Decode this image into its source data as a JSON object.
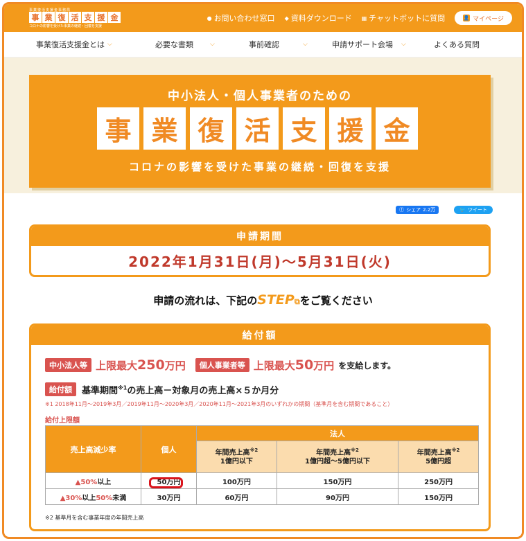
{
  "header": {
    "logo_top": "事業復活支援金事務局",
    "logo_chars": [
      "事",
      "業",
      "復",
      "活",
      "支",
      "援",
      "金"
    ],
    "logo_sub": "コロナの影響を受けた事業の継続・回復を支援",
    "links": [
      {
        "icon": "chat-icon",
        "label": "お問い合わせ窓口"
      },
      {
        "icon": "download-icon",
        "label": "資料ダウンロード"
      },
      {
        "icon": "chatbot-icon",
        "label": "チャットボットに質問"
      }
    ],
    "mypage_label": "マイページ"
  },
  "nav": {
    "items": [
      {
        "label": "事業復活支援金とは",
        "chevron": true
      },
      {
        "label": "必要な書類",
        "chevron": true
      },
      {
        "label": "事前確認",
        "chevron": true
      },
      {
        "label": "申請サポート会場",
        "chevron": true
      },
      {
        "label": "よくある質問",
        "chevron": false
      }
    ]
  },
  "hero": {
    "line1": "中小法人・個人事業者のための",
    "title_chars": [
      "事",
      "業",
      "復",
      "活",
      "支",
      "援",
      "金"
    ],
    "line3": "コロナの影響を受けた事業の継続・回復を支援"
  },
  "social": {
    "share_label": "シェア",
    "share_count": "2.2万",
    "tweet_label": "ツイート"
  },
  "period": {
    "heading": "申請期間",
    "value": "2022年1月31日(月)～5月31日(火)"
  },
  "flow": {
    "before": "申請の流れは、下記の",
    "step": "STEP",
    "after": "をご覧ください"
  },
  "amount": {
    "heading": "給付額",
    "corp_badge": "中小法人等",
    "corp_limit_pre": "上限最大",
    "corp_limit_num": "250",
    "corp_limit_unit": "万円",
    "indiv_badge": "個人事業者等",
    "indiv_limit_pre": "上限最大",
    "indiv_limit_num": "50",
    "indiv_limit_unit": "万円",
    "pay_text": "を支給します。",
    "formula_badge": "給付額",
    "formula_a": "基準期間",
    "formula_sup": "※1",
    "formula_b": "の売上高－対象月の売上高×５か月分",
    "note1": "※1 2018年11月～2019年3月／2019年11月～2020年3月／2020年11月～2021年3月のいずれかの期間（基準月を含む期間であること）",
    "cap_title": "給付上限額",
    "table": {
      "h_rate": "売上高減少率",
      "h_indiv": "個人",
      "h_corp": "法人",
      "corp_cols": [
        {
          "l1": "年間売上高",
          "sup": "※2",
          "l2": "1億円以下"
        },
        {
          "l1": "年間売上高",
          "sup": "※2",
          "l2": "1億円超～5億円以下"
        },
        {
          "l1": "年間売上高",
          "sup": "※2",
          "l2": "5億円超"
        }
      ],
      "rows": [
        {
          "rate_a": "▲50%",
          "rate_b": "以上",
          "rate_c": "",
          "rate_d": "",
          "indiv": "50万円",
          "c1": "100万円",
          "c2": "150万円",
          "c3": "250万円"
        },
        {
          "rate_a": "▲30%",
          "rate_b": "以上",
          "rate_c": "50%",
          "rate_d": "未満",
          "indiv": "30万円",
          "c1": "60万円",
          "c2": "90万円",
          "c3": "150万円"
        }
      ]
    },
    "note2": "※2 基準月を含む事業年度の年間売上高"
  }
}
